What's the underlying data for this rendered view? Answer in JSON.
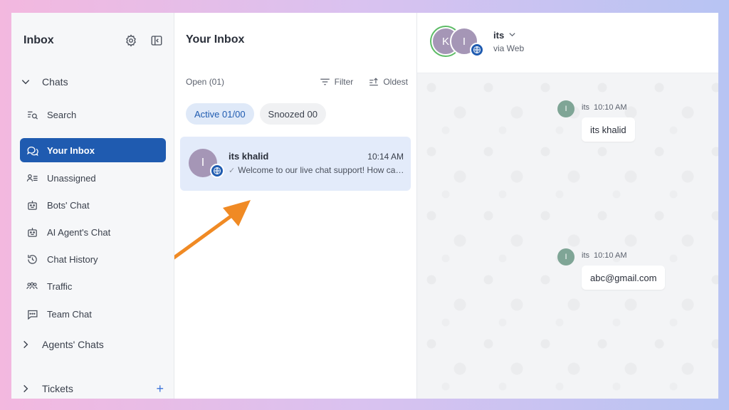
{
  "colors": {
    "primary": "#1f5bb0",
    "active_tab_bg": "#dfe9f8",
    "selected_conv_bg": "#e3ebfa",
    "avatar": "#a596b6",
    "msg_avatar": "#7fa596",
    "online": "#5dbb66",
    "arrow": "#f08a24"
  },
  "sidebar": {
    "title": "Inbox",
    "header_icons": [
      "gear-icon",
      "collapse-panel-icon"
    ],
    "sections": {
      "chats": "Chats",
      "agents_chats": "Agents' Chats",
      "tickets": "Tickets"
    },
    "items": [
      {
        "label": "Search",
        "icon": "search-list-icon"
      },
      {
        "label": "Your Inbox",
        "icon": "chat-bubbles-icon",
        "active": true
      },
      {
        "label": "Unassigned",
        "icon": "person-list-icon"
      },
      {
        "label": "Bots' Chat",
        "icon": "bot-icon"
      },
      {
        "label": "AI Agent's Chat",
        "icon": "bot-icon"
      },
      {
        "label": "Chat History",
        "icon": "history-icon"
      },
      {
        "label": "Traffic",
        "icon": "people-icon"
      },
      {
        "label": "Team Chat",
        "icon": "message-square-icon"
      }
    ],
    "tickets_add": "+"
  },
  "inbox": {
    "title": "Your Inbox",
    "open_count": "Open (01)",
    "filter_label": "Filter",
    "sort_label": "Oldest",
    "tabs": [
      {
        "label": "Active 01/00",
        "active": true
      },
      {
        "label": "Snoozed 00",
        "active": false
      }
    ],
    "conversations": [
      {
        "avatar_letter": "I",
        "name": "its khalid",
        "time": "10:14 AM",
        "preview": "Welcome to our live chat support! How can I help you today?",
        "channel_icon": "globe-icon"
      }
    ]
  },
  "chat": {
    "header": {
      "avatars": [
        "K",
        "I"
      ],
      "name": "its",
      "subtitle": "via Web"
    },
    "messages": [
      {
        "avatar_letter": "I",
        "sender": "its",
        "time": "10:10 AM",
        "text": "its khalid"
      },
      {
        "avatar_letter": "I",
        "sender": "its",
        "time": "10:10 AM",
        "text": "abc@gmail.com"
      }
    ]
  }
}
